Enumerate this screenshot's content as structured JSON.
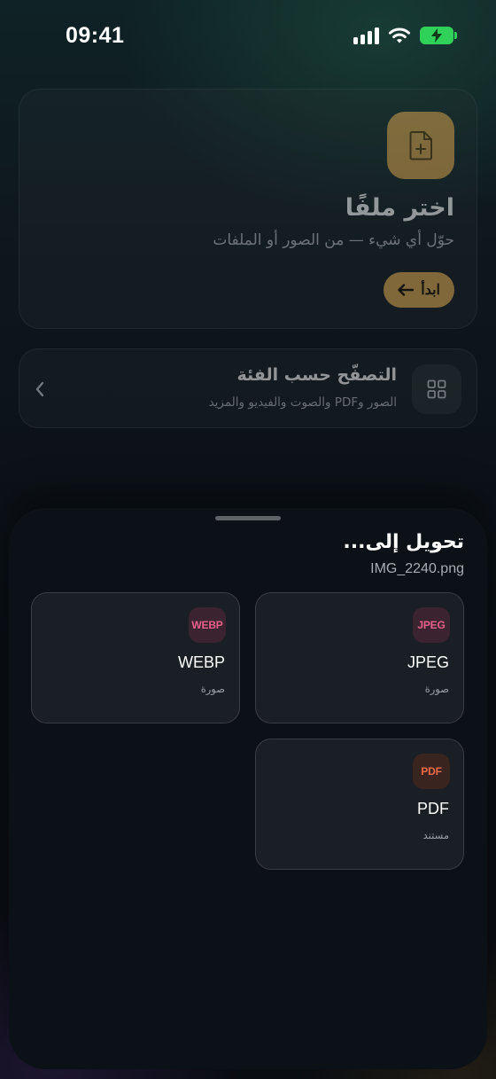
{
  "status_bar": {
    "time": "09:41",
    "battery_color": "#2fd158"
  },
  "hero": {
    "icon": "file-plus-icon",
    "title": "اختر ملفًا",
    "subtitle": "حوّل أي شيء — من الصور أو الملفات",
    "start_label": "ابدأ",
    "accent_color": "#e0ac55"
  },
  "browse": {
    "icon": "grid-icon",
    "title": "التصفّح حسب الفئة",
    "subtitle": "الصور وPDF والصوت والفيديو والمزيد"
  },
  "sheet": {
    "title": "تحويل إلى...",
    "filename": "IMG_2240.png",
    "formats": [
      {
        "badge": "JPEG",
        "name": "JPEG",
        "type": "صورة",
        "badge_color": "#e8608a"
      },
      {
        "badge": "WEBP",
        "name": "WEBP",
        "type": "صورة",
        "badge_color": "#e8608a"
      },
      {
        "badge": "PDF",
        "name": "PDF",
        "type": "مستند",
        "badge_color": "#ef6a45"
      }
    ]
  }
}
